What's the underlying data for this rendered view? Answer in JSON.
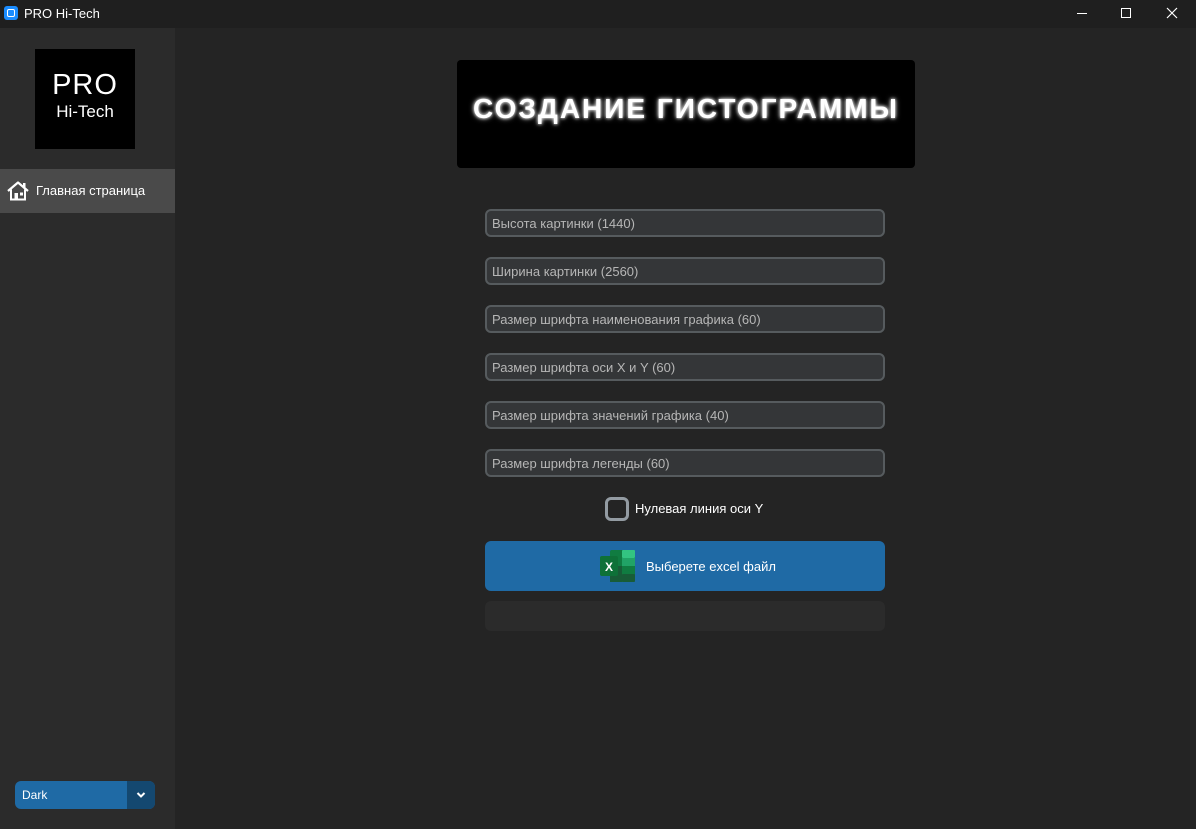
{
  "window": {
    "title": "PRO Hi-Tech",
    "controls": [
      "minimize",
      "maximize",
      "close"
    ]
  },
  "sidebar": {
    "logo": {
      "line1": "PRO",
      "line2": "Hi-Tech"
    },
    "nav": [
      {
        "label": "Главная страница",
        "icon": "home-icon",
        "active": true
      }
    ],
    "theme": {
      "value": "Dark"
    }
  },
  "main": {
    "banner_title": "Создание гистограммы",
    "fields": [
      {
        "placeholder": "Высота картинки (1440)"
      },
      {
        "placeholder": "Ширина картинки (2560)"
      },
      {
        "placeholder": "Размер шрифта наименования графика (60)"
      },
      {
        "placeholder": "Размер шрифта оси X и Y (60)"
      },
      {
        "placeholder": "Размер шрифта значений графика (40)"
      },
      {
        "placeholder": "Размер шрифта легенды (60)"
      }
    ],
    "checkbox": {
      "label": "Нулевая линия оси Y",
      "checked": false
    },
    "excel_button": {
      "label": "Выберете excel файл",
      "icon": "excel-icon",
      "icon_letter": "X"
    }
  },
  "colors": {
    "accent": "#1f6aa5",
    "background": "#242424",
    "sidebar": "#2b2b2b",
    "field_bg": "#343638",
    "field_border": "#565b5e",
    "nav_active": "#4a4a4a"
  }
}
